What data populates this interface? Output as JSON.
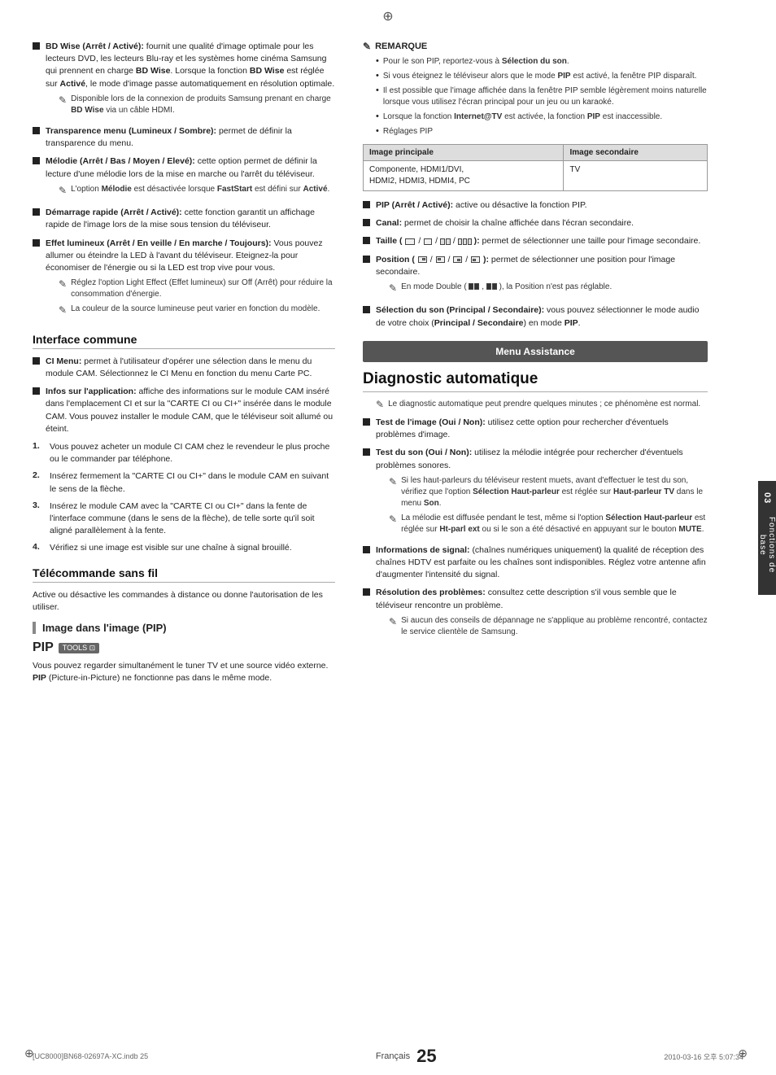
{
  "page": {
    "crosshair_top": "⊕",
    "crosshair_bottom_left": "⊕",
    "crosshair_bottom_right": "⊕",
    "side_tab": "Fonctions de base",
    "side_tab_number": "03",
    "footer_left": "[UC8000]BN68-02697A-XC.indb   25",
    "footer_right": "2010-03-16   오후 5:07:34",
    "footer_lang": "Français",
    "footer_page": "25"
  },
  "left_col": {
    "sections": {
      "bullets": [
        {
          "id": "bd_wise",
          "text_bold": "BD Wise (Arrêt / Activé):",
          "text": " fournit une qualité d'image optimale pour les lecteurs DVD, les lecteurs Blu-ray et les systèmes home cinéma Samsung qui prennent en charge BD Wise. Lorsque la fonction BD Wise est réglée sur Activé, le mode d'image passe automatiquement en résolution optimale.",
          "note": "Disponible lors de la connexion de produits Samsung prenant en charge BD Wise via un câble HDMI."
        },
        {
          "id": "transparence",
          "text_bold": "Transparence menu (Lumineux / Sombre):",
          "text": " permet de définir la transparence du menu."
        },
        {
          "id": "melodie",
          "text_bold": "Mélodie (Arrêt / Bas / Moyen / Elevé):",
          "text": " cette option permet de définir la lecture d'une mélodie lors de la mise en marche ou l'arrêt du téléviseur.",
          "note": "L'option Mélodie est désactivée lorsque FastStart est défini sur Activé."
        },
        {
          "id": "demarrage",
          "text_bold": "Démarrage rapide (Arrêt / Activé):",
          "text": " cette fonction garantit un affichage rapide de l'image lors de la mise sous tension du téléviseur."
        },
        {
          "id": "effet",
          "text_bold": "Effet lumineux (Arrêt / En veille / En marche / Toujours):",
          "text": " Vous pouvez allumer ou éteindre la LED à l'avant du téléviseur. Eteignez-la pour économiser de l'énergie ou si la LED est trop vive pour vous.",
          "notes": [
            "Réglez l'option Light Effect (Effet lumineux) sur Off (Arrêt) pour réduire la consommation d'énergie.",
            "La couleur de la source lumineuse peut varier en fonction du modèle."
          ]
        }
      ],
      "interface_commune": {
        "title": "Interface commune",
        "items": [
          {
            "id": "ci_menu",
            "text_bold": "CI Menu:",
            "text": " permet à l'utilisateur d'opérer une sélection dans le menu du module CAM. Sélectionnez le CI Menu en fonction du menu Carte PC."
          },
          {
            "id": "infos",
            "text_bold": "Infos sur l'application:",
            "text": " affiche des informations sur le module CAM inséré dans l'emplacement CI et sur la \"CARTE CI ou CI+\" insérée dans le module CAM. Vous pouvez installer le module CAM, que le téléviseur soit allumé ou éteint."
          }
        ],
        "numbered": [
          {
            "num": "1.",
            "text": "Vous pouvez acheter un module CI CAM chez le revendeur le plus proche ou le commander par téléphone."
          },
          {
            "num": "2.",
            "text": "Insérez fermement la \"CARTE CI ou CI+\" dans le module CAM en suivant le sens de la flèche."
          },
          {
            "num": "3.",
            "text": "Insérez le module CAM avec la \"CARTE CI ou CI+\" dans la fente de l'interface commune (dans le sens de la flèche), de telle sorte qu'il soit aligné parallèlement à la fente."
          },
          {
            "num": "4.",
            "text": "Vérifiez si une image est visible sur une chaîne à signal brouillé."
          }
        ]
      },
      "telecommande": {
        "title": "Télécommande sans fil",
        "text": "Active ou désactive les commandes à distance ou donne l'autorisation de les utiliser."
      },
      "image_dans": {
        "title": "Image dans l'image (PIP)"
      },
      "pip_section": {
        "title": "PIP",
        "tools_label": "TOOLS",
        "text": "Vous pouvez regarder simultanément le tuner TV et une source vidéo externe. PIP (Picture-in-Picture) ne fonctionne pas dans le même mode."
      }
    }
  },
  "right_col": {
    "remarque": {
      "title": "REMARQUE",
      "items": [
        "Pour le son PIP, reportez-vous à Sélection du son.",
        "Si vous éteignez le téléviseur alors que le mode PIP est activé, la fenêtre PIP disparaît.",
        "Il est possible que l'image affichée dans la fenêtre PIP semble légèrement moins naturelle lorsque vous utilisez l'écran principal pour un jeu ou un karaoké.",
        "Lorsque la fonction Internet@TV est activée, la fonction PIP est inaccessible.",
        "Réglages PIP"
      ]
    },
    "table": {
      "headers": [
        "Image principale",
        "Image secondaire"
      ],
      "rows": [
        [
          "Componente, HDMI1/DVI,\nHDMI2, HDMI3, HDMI4, PC",
          "TV"
        ]
      ]
    },
    "pip_bullets": [
      {
        "id": "pip_arret",
        "text_bold": "PIP (Arrêt / Activé):",
        "text": " active ou désactive la fonction PIP."
      },
      {
        "id": "canal",
        "text_bold": "Canal:",
        "text": " permet de choisir la chaîne affichée dans l'écran secondaire."
      },
      {
        "id": "taille",
        "text_bold": "Taille (",
        "text": "): permet de sélectionner une taille pour l'image secondaire.",
        "has_icons": true
      },
      {
        "id": "position",
        "text_bold": "Position (",
        "text": "): permet de sélectionner une position pour l'image secondaire.",
        "has_icons": true,
        "note": "En mode Double (  ,  ), la Position n'est pas réglable."
      },
      {
        "id": "selection_son",
        "text_bold": "Sélection du son (Principal / Secondaire):",
        "text": " vous pouvez sélectionner le mode audio de votre choix (Principal / Secondaire) en mode PIP."
      }
    ],
    "menu_assistance": {
      "title": "Menu Assistance"
    },
    "diagnostic": {
      "title": "Diagnostic automatique",
      "intro_note": "Le diagnostic automatique peut prendre quelques minutes ; ce phénomène est normal.",
      "items": [
        {
          "id": "test_image",
          "text_bold": "Test de l'image (Oui / Non):",
          "text": " utilisez cette option pour rechercher d'éventuels problèmes d'image."
        },
        {
          "id": "test_son",
          "text_bold": "Test du son (Oui / Non):",
          "text": " utilisez la mélodie intégrée pour rechercher d'éventuels problèmes sonores.",
          "notes": [
            "Si les haut-parleurs du téléviseur restent muets, avant d'effectuer le test du son, vérifiez que l'option Sélection Haut-parleur est réglée sur Haut-parleur TV dans le menu Son.",
            "La mélodie est diffusée pendant le test, même si l'option Sélection Haut-parleur est réglée sur Ht-parl ext ou si le son a été désactivé en appuyant sur le bouton MUTE."
          ]
        },
        {
          "id": "info_signal",
          "text_bold": "Informations de signal:",
          "text": " (chaînes numériques uniquement) la qualité de réception des chaînes HDTV est parfaite ou les chaînes sont indisponibles. Réglez votre antenne afin d'augmenter l'intensité du signal."
        },
        {
          "id": "resolution",
          "text_bold": "Résolution des problèmes:",
          "text": " consultez cette description s'il vous semble que le téléviseur rencontre un problème.",
          "note": "Si aucun des conseils de dépannage ne s'applique au problème rencontré, contactez le service clientèle de Samsung."
        }
      ]
    }
  }
}
